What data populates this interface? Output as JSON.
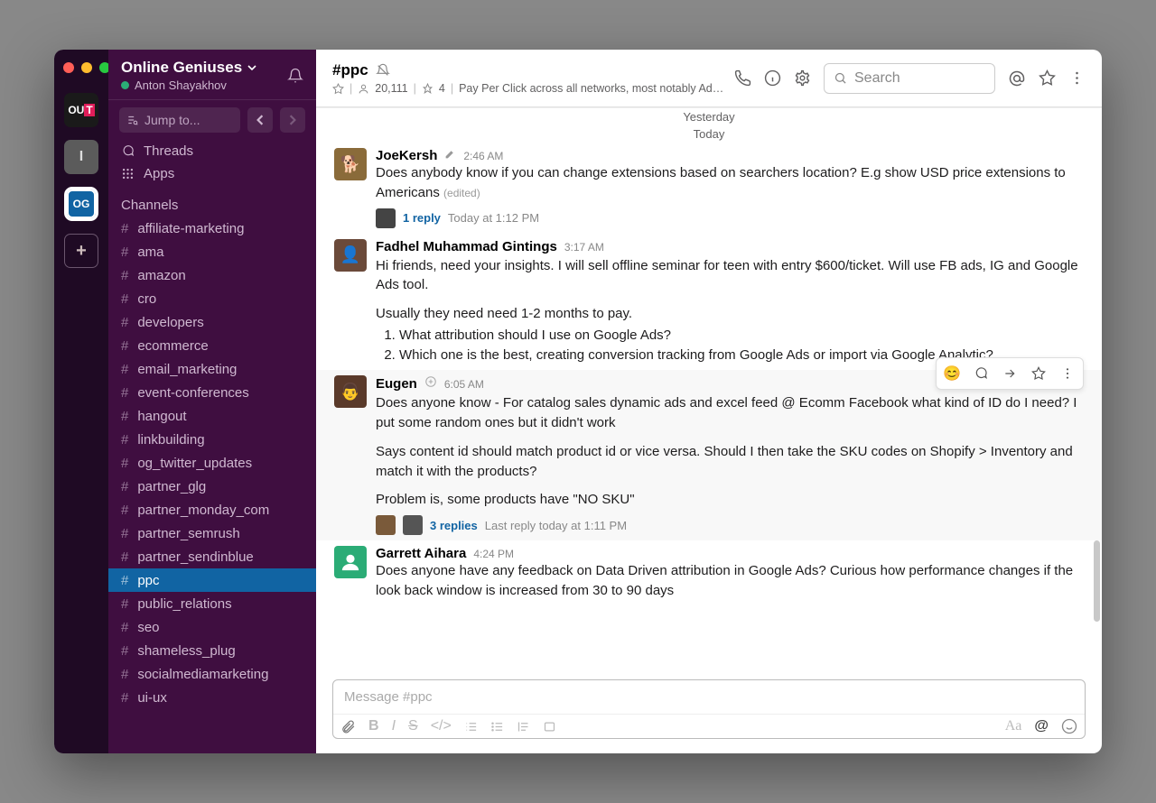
{
  "workspace_strip": {
    "add_label": "+"
  },
  "sidebar": {
    "workspace_name": "Online Geniuses",
    "user_name": "Anton Shayakhov",
    "jump_placeholder": "Jump to...",
    "threads": "Threads",
    "apps": "Apps",
    "channels_label": "Channels",
    "channels": [
      "affiliate-marketing",
      "ama",
      "amazon",
      "cro",
      "developers",
      "ecommerce",
      "email_marketing",
      "event-conferences",
      "hangout",
      "linkbuilding",
      "og_twitter_updates",
      "partner_glg",
      "partner_monday_com",
      "partner_semrush",
      "partner_sendinblue",
      "ppc",
      "public_relations",
      "seo",
      "shameless_plug",
      "socialmediamarketing",
      "ui-ux"
    ],
    "active_channel": "ppc"
  },
  "header": {
    "channel_name": "#ppc",
    "members": "20,111",
    "pins": "4",
    "topic": "Pay Per Click across all networks, most notably Ad…",
    "search_placeholder": "Search"
  },
  "dividers": {
    "yesterday": "Yesterday",
    "today": "Today"
  },
  "messages": [
    {
      "user": "JoeKersh",
      "time": "2:46 AM",
      "text": "Does anybody know if you can change extensions based on searchers location? E.g show USD price extensions to Americans",
      "edited": "(edited)",
      "thread": {
        "replies": "1 reply",
        "time": "Today at 1:12 PM"
      }
    },
    {
      "user": "Fadhel Muhammad Gintings",
      "time": "3:17 AM",
      "intro": "Hi friends, need your insights. I will sell offline seminar for teen with entry $600/ticket. Will use FB ads, IG and Google Ads tool.",
      "line2": "Usually they need need 1-2 months to pay.",
      "q1": "What attribution should I use on Google Ads?",
      "q2": "Which one is the best, creating conversion tracking from Google Ads or import via Google Analytic?"
    },
    {
      "user": "Eugen",
      "time": "6:05 AM",
      "p1": "Does anyone know - For catalog sales dynamic ads and excel feed @ Ecomm Facebook what kind of ID do I need? I put some random ones but it didn't work",
      "p2": "Says content id should match product id or vice versa. Should I then take the SKU codes on Shopify > Inventory and match it with the products?",
      "p3": "Problem is, some products have \"NO SKU\"",
      "thread": {
        "replies": "3 replies",
        "time": "Last reply today at 1:11 PM"
      }
    },
    {
      "user": "Garrett Aihara",
      "time": "4:24 PM",
      "text": "Does anyone have any feedback on Data Driven attribution in Google Ads? Curious how performance changes if the look back window is increased from 30 to 90 days"
    }
  ],
  "composer": {
    "placeholder": "Message #ppc"
  }
}
